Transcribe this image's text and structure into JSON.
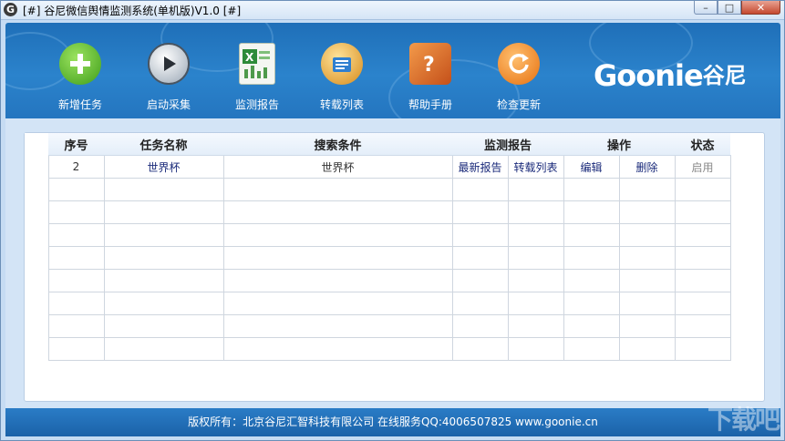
{
  "window": {
    "title": "[#] 谷尼微信舆情监测系统(单机版)V1.0 [#]",
    "app_icon": "G"
  },
  "toolbar": {
    "items": [
      {
        "label": "新增任务",
        "icon": "plus-icon",
        "color": "#5cbf2a"
      },
      {
        "label": "启动采集",
        "icon": "play-icon",
        "color": "#e6ecf2"
      },
      {
        "label": "监测报告",
        "icon": "excel-icon",
        "color": "#2e8b3a"
      },
      {
        "label": "转载列表",
        "icon": "list-icon",
        "color": "#f0b030"
      },
      {
        "label": "帮助手册",
        "icon": "help-book-icon",
        "color": "#e46a1e"
      },
      {
        "label": "检查更新",
        "icon": "refresh-icon",
        "color": "#f08a1c"
      }
    ]
  },
  "brand": {
    "logo_latin": "Goonie",
    "logo_cn": "谷尼"
  },
  "table": {
    "headers": [
      "序号",
      "任务名称",
      "搜索条件",
      "监测报告",
      "操作",
      "状态"
    ],
    "rows": [
      {
        "index": "2",
        "name": "世界杯",
        "query": "世界杯",
        "report_latest": "最新报告",
        "report_reprint": "转载列表",
        "edit": "编辑",
        "delete": "删除",
        "status": "启用"
      }
    ]
  },
  "footer": {
    "text": "版权所有：北京谷尼汇智科技有限公司 在线服务QQ:4006507825 www.goonie.cn"
  },
  "watermark": "下载吧"
}
